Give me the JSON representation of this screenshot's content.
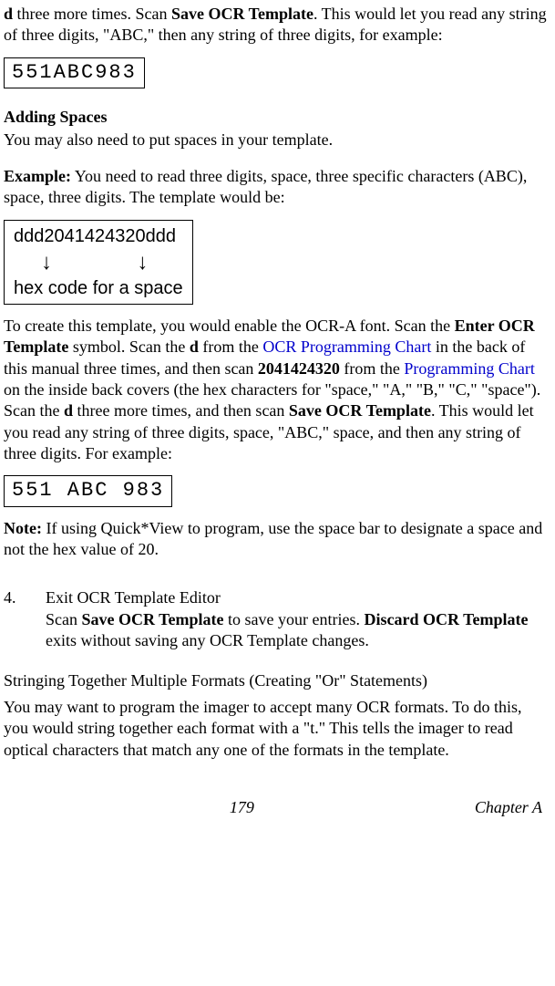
{
  "intro": {
    "p1a": "d",
    "p1b": " three more times. Scan ",
    "p1c": "Save OCR Template",
    "p1d": ". This would let you read any string of three digits, \"ABC,\" then any string of three digits, for example:"
  },
  "img1": "551ABC983",
  "heading1": "Adding Spaces",
  "p2": "You may also need to put spaces in your template.",
  "example": {
    "label": "Example:",
    "text": " You need to read three digits, space, three specific characters (ABC), space, three digits. The template would be:"
  },
  "hexbox": {
    "line1": "ddd2041424320ddd",
    "arrows": "↓              ↓",
    "line3": "hex code for a space"
  },
  "p3": {
    "a": "To create this template, you would enable the OCR-A font. Scan the ",
    "b": "Enter OCR Template",
    "c": " symbol. Scan the ",
    "d": "d",
    "e": " from the ",
    "f": "OCR Programming Chart",
    "g": " in the back of this manual three times, and then scan ",
    "h": "2041424320",
    "i": " from the ",
    "j": "Programming Chart",
    "k": " on the inside back covers (the hex charac­ters for \"space,\" \"A,\" \"B,\" \"C,\" \"space\"). Scan the ",
    "l": "d",
    "m": " three more times, and then scan ",
    "n": "Save OCR Template",
    "o": ". This would let you read any string of three digits, space, \"ABC,\" space, and then any string of three digits. For example:"
  },
  "img2": "551 ABC 983",
  "note": {
    "label": "Note:",
    "text": " If using Quick*View to program, use the space bar to designate a space and not the hex value of 20."
  },
  "step4": {
    "num": "4.",
    "title": "Exit OCR Template Editor",
    "a": "Scan ",
    "b": "Save OCR Template",
    "c": " to save your entries. ",
    "d": "Discard OCR Template",
    "e": " exits without saving any OCR Template changes."
  },
  "heading2": "Stringing Together Multiple Formats (Creating \"Or\" Statements)",
  "p4": "You may want to program the imager to accept many OCR formats. To do this, you would string together each format with a \"t.\" This tells the imager to read optical characters that match any one of the formats in the template.",
  "footer": {
    "page": "179",
    "chapter": "Chapter A"
  }
}
